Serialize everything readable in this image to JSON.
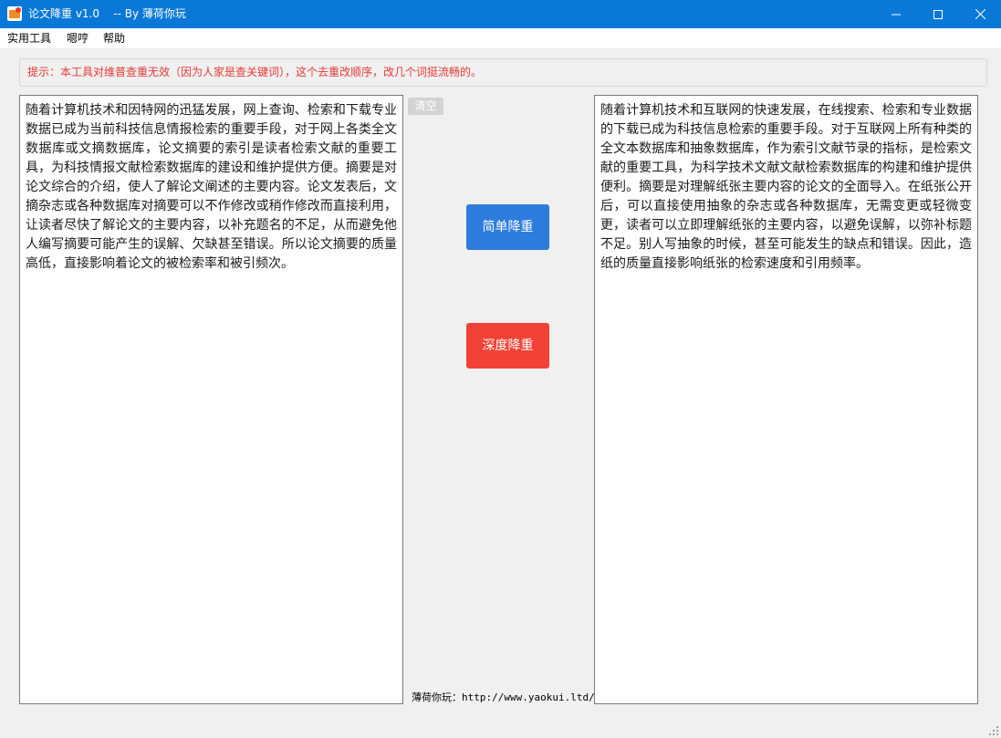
{
  "window": {
    "title": "论文降重 v1.0    -- By 薄荷你玩",
    "icons": {
      "app": "app-icon",
      "minimize": "minimize-icon",
      "maximize": "maximize-icon",
      "close": "close-icon"
    }
  },
  "menu": {
    "items": [
      "实用工具",
      "嗯哼",
      "帮助"
    ]
  },
  "hint": {
    "text": "提示：本工具对维普查重无效（因为人家是查关键词），这个去重改顺序，改几个词挺流畅的。"
  },
  "input": {
    "text": "随着计算机技术和因特网的迅猛发展，网上查询、检索和下载专业数据已成为当前科技信息情报检索的重要手段，对于网上各类全文数据库或文摘数据库，论文摘要的索引是读者检索文献的重要工具，为科技情报文献检索数据库的建设和维护提供方便。摘要是对论文综合的介绍，使人了解论文阐述的主要内容。论文发表后，文摘杂志或各种数据库对摘要可以不作修改或稍作修改而直接利用，让读者尽快了解论文的主要内容，以补充题名的不足，从而避免他人编写摘要可能产生的误解、欠缺甚至错误。所以论文摘要的质量高低，直接影响着论文的被检索率和被引频次。"
  },
  "output": {
    "text": "随着计算机技术和互联网的快速发展，在线搜索、检索和专业数据的下载已成为科技信息检索的重要手段。对于互联网上所有种类的全文本数据库和抽象数据库，作为索引文献节录的指标，是检索文献的重要工具，为科学技术文献文献检索数据库的构建和维护提供便利。摘要是对理解纸张主要内容的论文的全面导入。在纸张公开后，可以直接使用抽象的杂志或各种数据库，无需变更或轻微变更，读者可以立即理解纸张的主要内容，以避免误解，以弥补标题不足。别人写抽象的时候，甚至可能发生的缺点和错误。因此，造纸的质量直接影响纸张的检索速度和引用频率。"
  },
  "buttons": {
    "clear": "清空",
    "simple": "简单降重",
    "deep": "深度降重"
  },
  "colors": {
    "titlebar": "#0a78d7",
    "simple_button": "#2e7cdc",
    "deep_button": "#f24236",
    "hint_text": "#e53935",
    "clear_button": "#d3d3d3"
  },
  "footer": {
    "text": "薄荷你玩：http://www.yaokui.ltd/"
  }
}
